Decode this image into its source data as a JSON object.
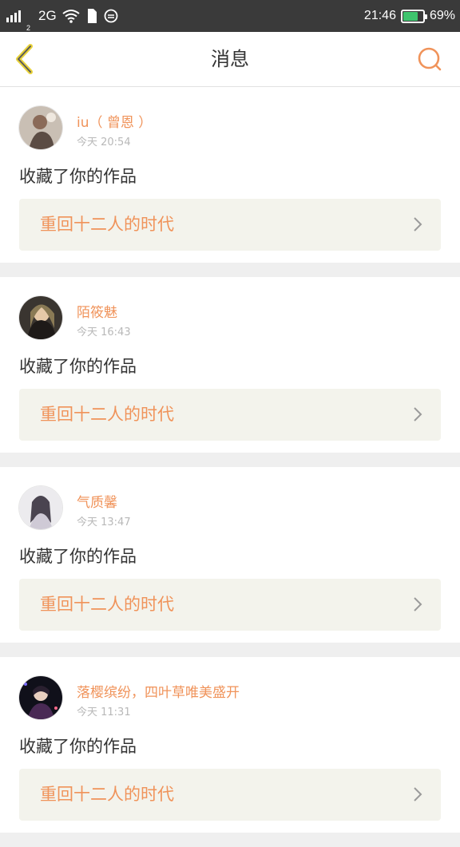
{
  "status_bar": {
    "signal_sub": "2",
    "network": "2G",
    "time": "21:46",
    "battery_percent": "69%",
    "battery_level": 0.69,
    "battery_color": "#3ec46d"
  },
  "header": {
    "title": "消息",
    "back_icon": "chevron-left-icon",
    "search_icon": "search-icon",
    "accent_color": "#f0935a"
  },
  "messages": [
    {
      "username": "iu（ 曾恩 ）",
      "time": "今天 20:54",
      "action": "收藏了你的作品",
      "work_title": "重回十二人的时代"
    },
    {
      "username": "陌筱魅",
      "time": "今天 16:43",
      "action": "收藏了你的作品",
      "work_title": "重回十二人的时代"
    },
    {
      "username": "气质馨",
      "time": "今天 13:47",
      "action": "收藏了你的作品",
      "work_title": "重回十二人的时代"
    },
    {
      "username": "落樱缤纷，四叶草唯美盛开",
      "time": "今天 11:31",
      "action": "收藏了你的作品",
      "work_title": "重回十二人的时代"
    }
  ]
}
